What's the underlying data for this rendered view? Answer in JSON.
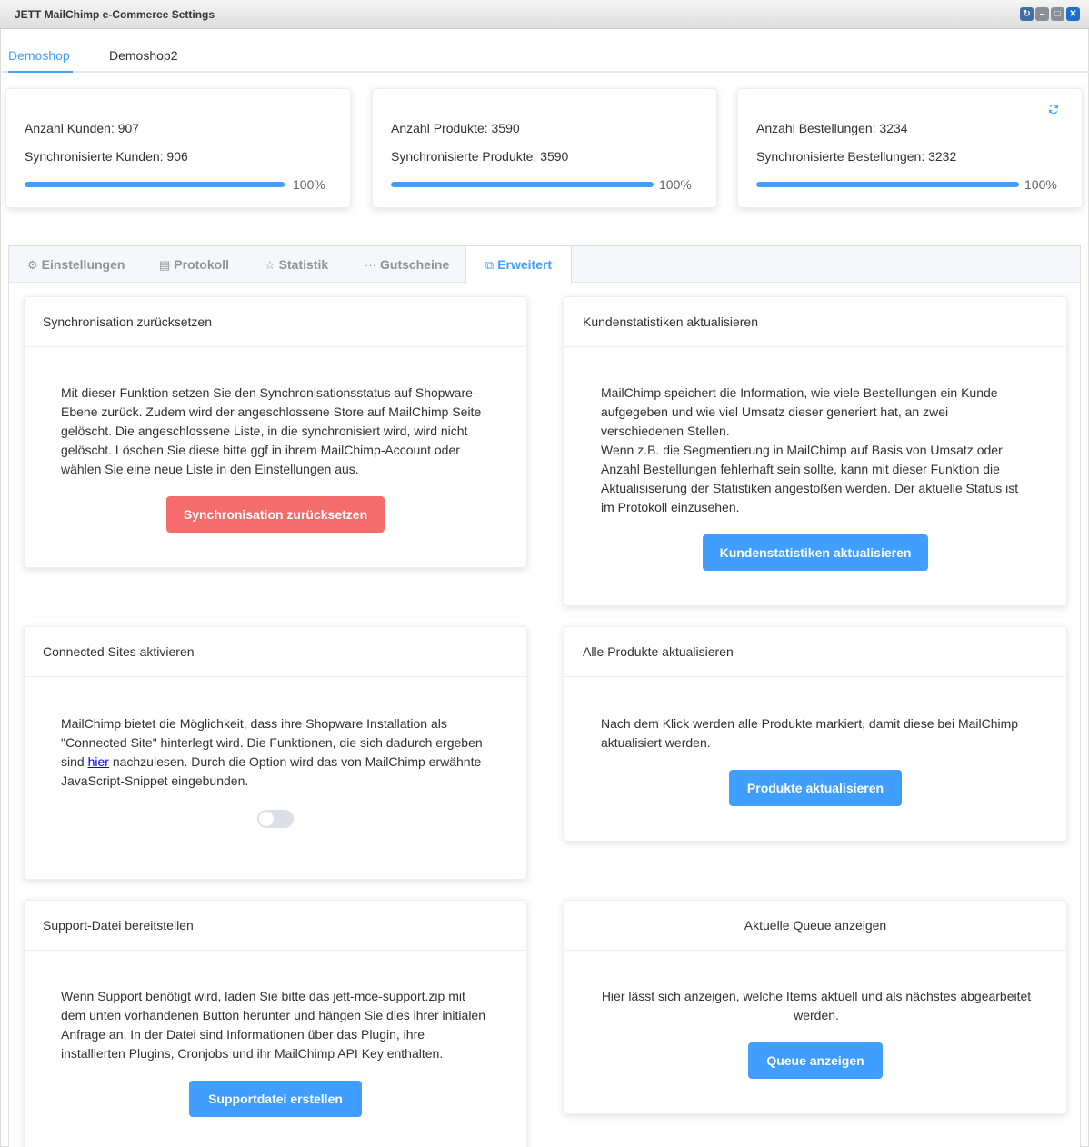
{
  "window": {
    "title": "JETT MailChimp e-Commerce Settings"
  },
  "shop_tabs": [
    {
      "label": "Demoshop",
      "active": true
    },
    {
      "label": "Demoshop2",
      "active": false
    }
  ],
  "stats": [
    {
      "total": "Anzahl Kunden: 907",
      "synced": "Synchronisierte Kunden: 906",
      "percent_label": "100%",
      "percent": 99
    },
    {
      "total": "Anzahl Produkte: 3590",
      "synced": "Synchronisierte Produkte: 3590",
      "percent_label": "100%",
      "percent": 100
    },
    {
      "total": "Anzahl Bestellungen: 3234",
      "synced": "Synchronisierte Bestellungen: 3232",
      "percent_label": "100%",
      "percent": 99.9
    }
  ],
  "tabs": [
    {
      "label": "Einstellungen",
      "icon": "gear-icon"
    },
    {
      "label": "Protokoll",
      "icon": "document-icon"
    },
    {
      "label": "Statistik",
      "icon": "star-icon"
    },
    {
      "label": "Gutscheine",
      "icon": "more-icon"
    },
    {
      "label": "Erweitert",
      "icon": "external-edit-icon",
      "active": true
    }
  ],
  "cards": {
    "reset": {
      "title": "Synchronisation zurücksetzen",
      "text": "Mit dieser Funktion setzen Sie den Synchronisationsstatus auf Shopware-Ebene zurück. Zudem wird der angeschlossene Store auf MailChimp Seite gelöscht. Die angeschlossene Liste, in die synchronisiert wird, wird nicht gelöscht. Löschen Sie diese bitte ggf in ihrem MailChimp-Account oder wählen Sie eine neue Liste in den Einstellungen aus.",
      "button": "Synchronisation zurücksetzen"
    },
    "customer_stats": {
      "title": "Kundenstatistiken aktualisieren",
      "text1": "MailChimp speichert die Information, wie viele Bestellungen ein Kunde aufgegeben und wie viel Umsatz dieser generiert hat, an zwei verschiedenen Stellen.",
      "text2": "Wenn z.B. die Segmentierung in MailChimp auf Basis von Umsatz oder Anzahl Bestellungen fehlerhaft sein sollte, kann mit dieser Funktion die Aktualisiserung der Statistiken angestoßen werden. Der aktuelle Status ist im Protokoll einzusehen.",
      "button": "Kundenstatistiken aktualisieren"
    },
    "connected_sites": {
      "title": "Connected Sites aktivieren",
      "text_before": "MailChimp bietet die Möglichkeit, dass ihre Shopware Installation als \"Connected Site\" hinterlegt wird. Die Funktionen, die sich dadurch ergeben sind ",
      "link": "hier",
      "text_after": " nachzulesen. Durch die Option wird das von MailChimp erwähnte JavaScript-Snippet eingebunden.",
      "enabled": false
    },
    "products": {
      "title": "Alle Produkte aktualisieren",
      "text": "Nach dem Klick werden alle Produkte markiert, damit diese bei MailChimp aktualisiert werden.",
      "button": "Produkte aktualisieren"
    },
    "support": {
      "title": "Support-Datei bereitstellen",
      "text": "Wenn Support benötigt wird, laden Sie bitte das jett-mce-support.zip mit dem unten vorhandenen Button herunter und hängen Sie dies ihrer initialen Anfrage an. In der Datei sind Informationen über das Plugin, ihre installierten Plugins, Cronjobs und ihr MailChimp API Key enthalten.",
      "button": "Supportdatei erstellen"
    },
    "queue": {
      "title": "Aktuelle Queue anzeigen",
      "text": "Hier lässt sich anzeigen, welche Items aktuell und als nächstes abgearbeitet werden.",
      "button": "Queue anzeigen"
    }
  },
  "colors": {
    "primary": "#409eff",
    "danger": "#f56c6c"
  }
}
